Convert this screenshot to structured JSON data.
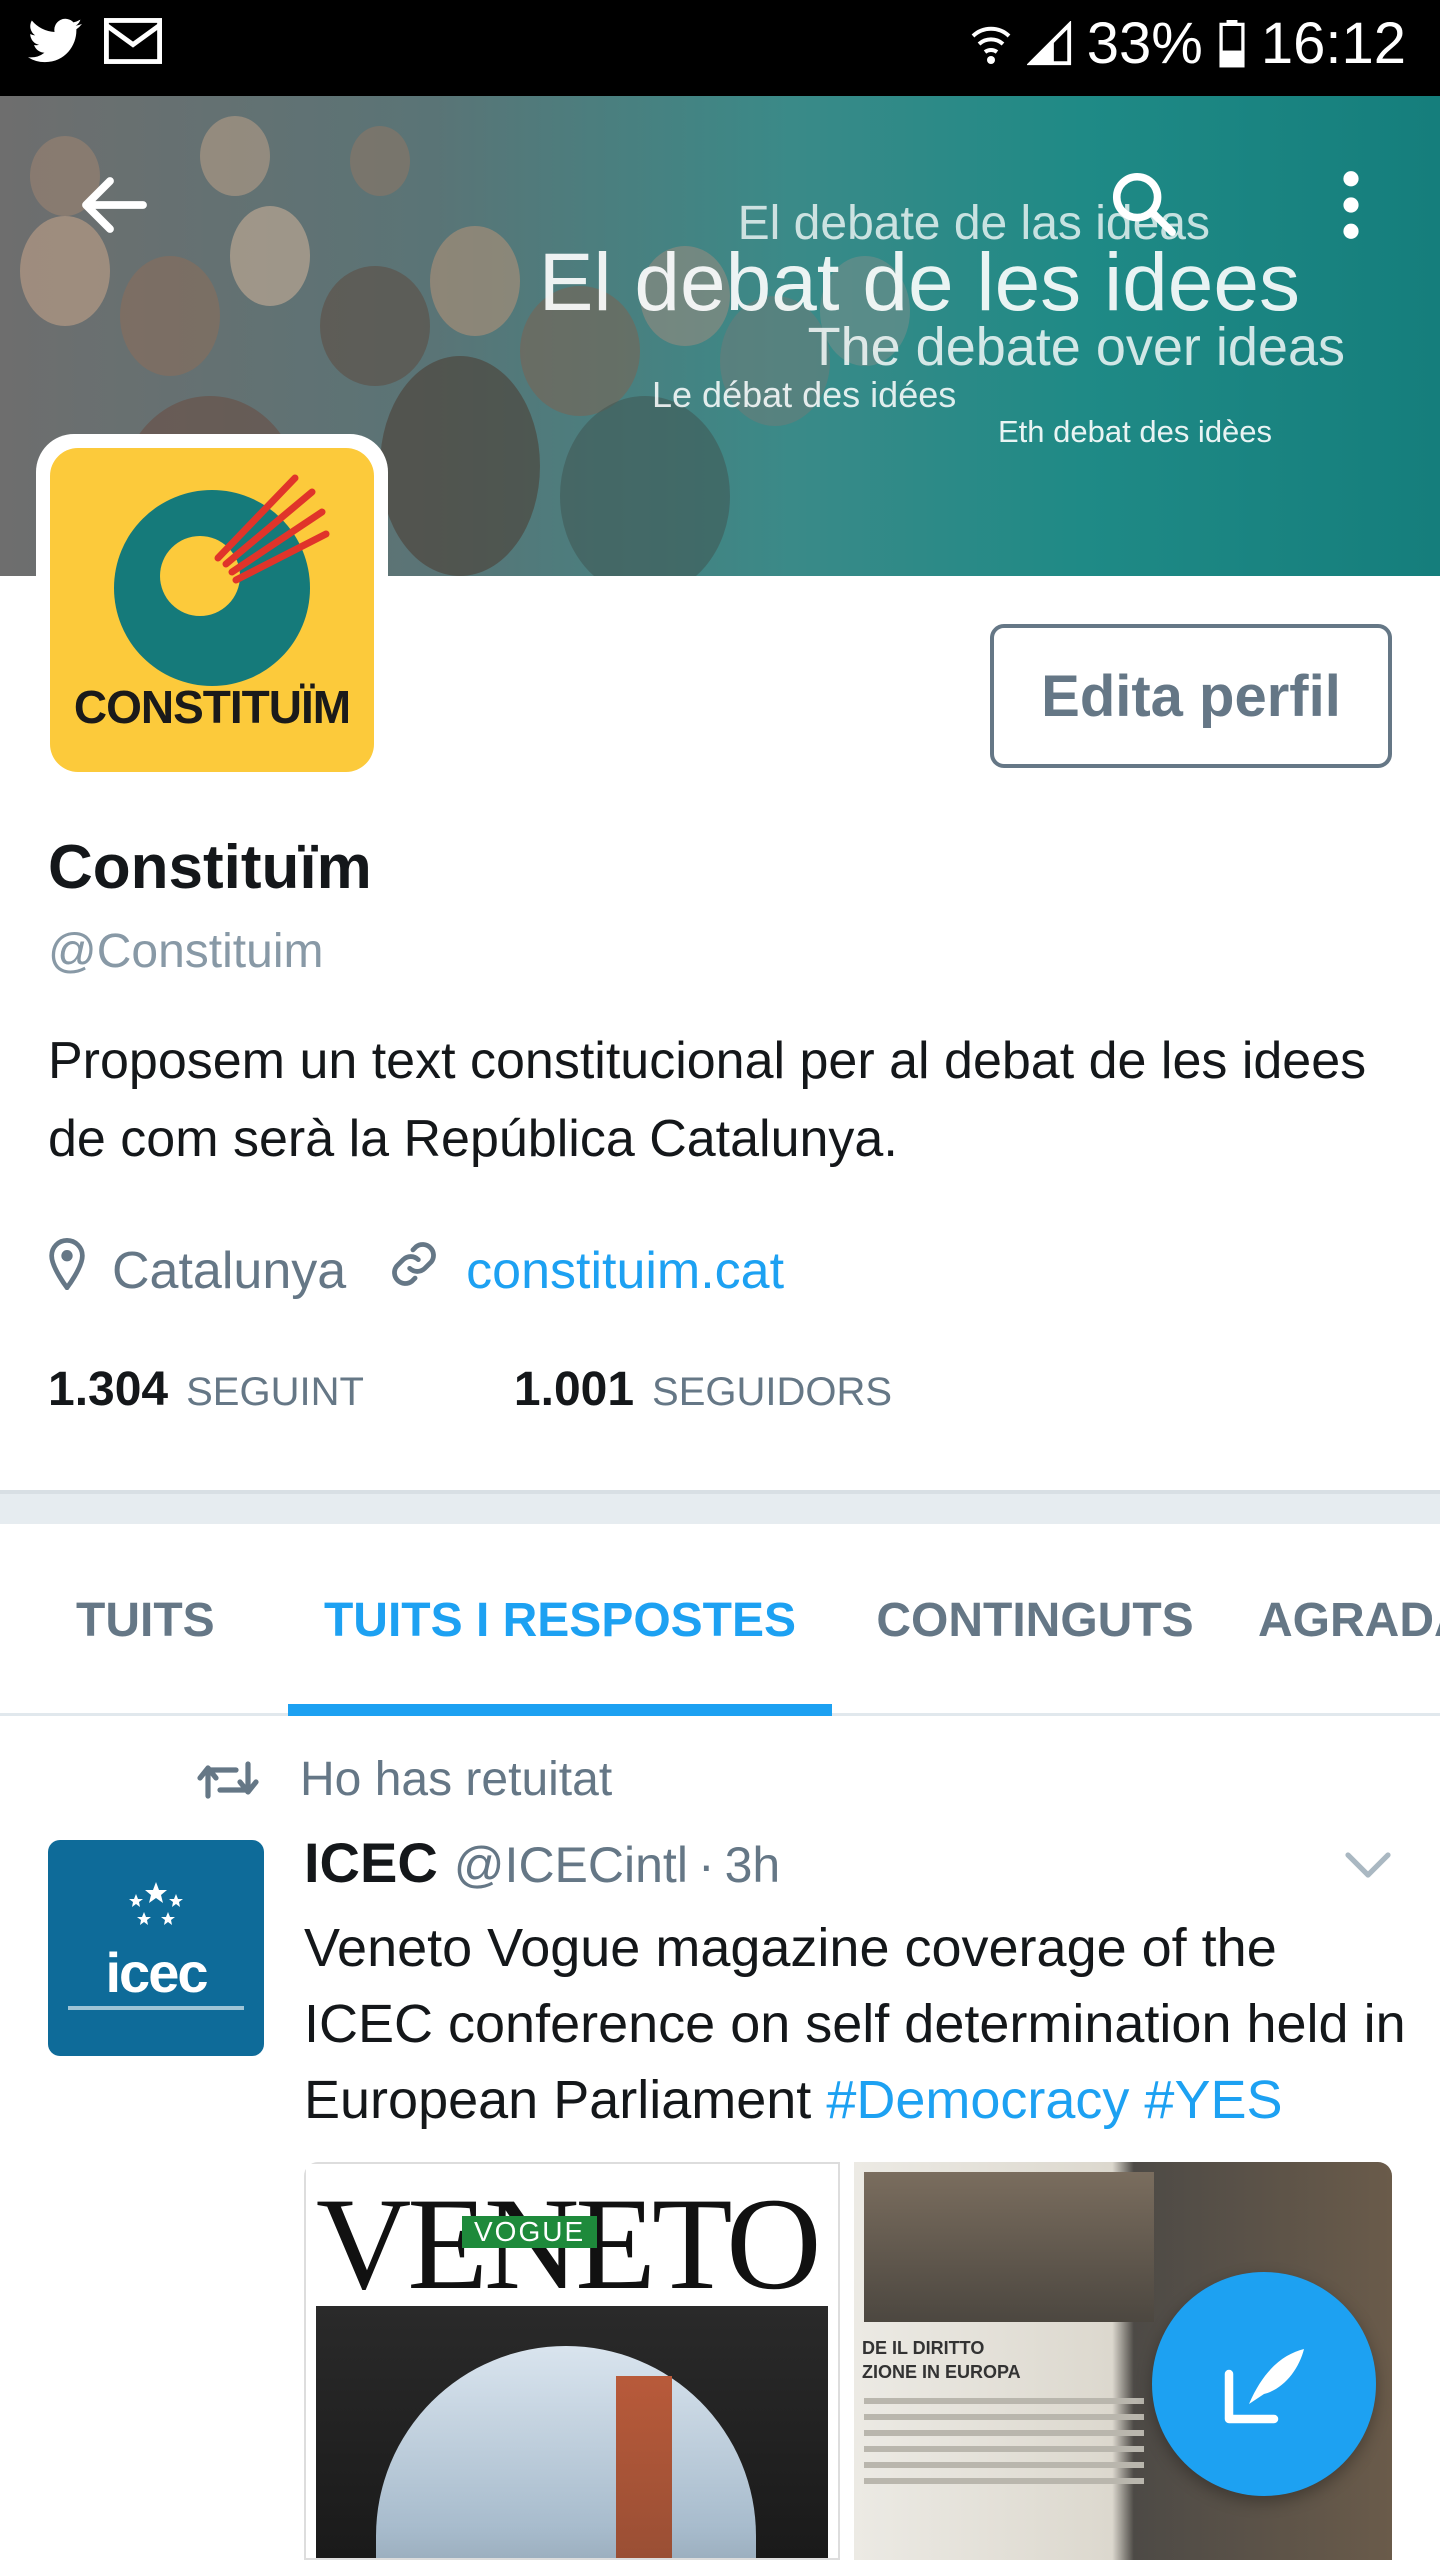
{
  "status_bar": {
    "battery": "33%",
    "time": "16:12",
    "icons": [
      "twitter-icon",
      "mail-icon",
      "wifi-icon",
      "signal-icon",
      "battery-icon"
    ]
  },
  "banner": {
    "line_es": "El debate de las ideas",
    "line_ca": "El debat de les idees",
    "line_en": "The debate over ideas",
    "line_fr": "Le débat des idées",
    "line_oc": "Eth debat des idèes"
  },
  "avatar": {
    "word": "CONSTITUÏM"
  },
  "profile": {
    "edit_label": "Edita perfil",
    "name": "Constituïm",
    "handle": "@Constituim",
    "bio": "Proposem un text constitucional per al debat de les idees de com serà la República Catalunya.",
    "location": "Catalunya",
    "url": "constituim.cat",
    "following_count": "1.304",
    "following_label": "SEGUINT",
    "followers_count": "1.001",
    "followers_label": "SEGUIDORS"
  },
  "tabs": [
    {
      "label": "TUITS"
    },
    {
      "label": "TUITS I RESPOSTES",
      "active": true
    },
    {
      "label": "CONTINGUTS"
    },
    {
      "label": "AGRADA"
    }
  ],
  "tweet": {
    "retweet_note": "Ho has retuitat",
    "avatar_text": "icec",
    "name": "ICEC",
    "handle": "@ICECintl",
    "time": "3h",
    "text": "Veneto Vogue magazine coverage of the ICEC conference on self determination held in European Parliament ",
    "hashtags": [
      "#Democracy",
      "#YES"
    ],
    "media_1_title": "VENETO",
    "media_1_label": "VOGUE",
    "media_2_head_1": "DE IL DIRITTO",
    "media_2_head_2": "ZIONE IN EUROPA"
  },
  "colors": {
    "accent": "#1da1f2",
    "secondary_text": "#657786",
    "avatar_yellow": "#fcca3b",
    "avatar_teal": "#157a7a",
    "icec_blue": "#0e6b99"
  }
}
